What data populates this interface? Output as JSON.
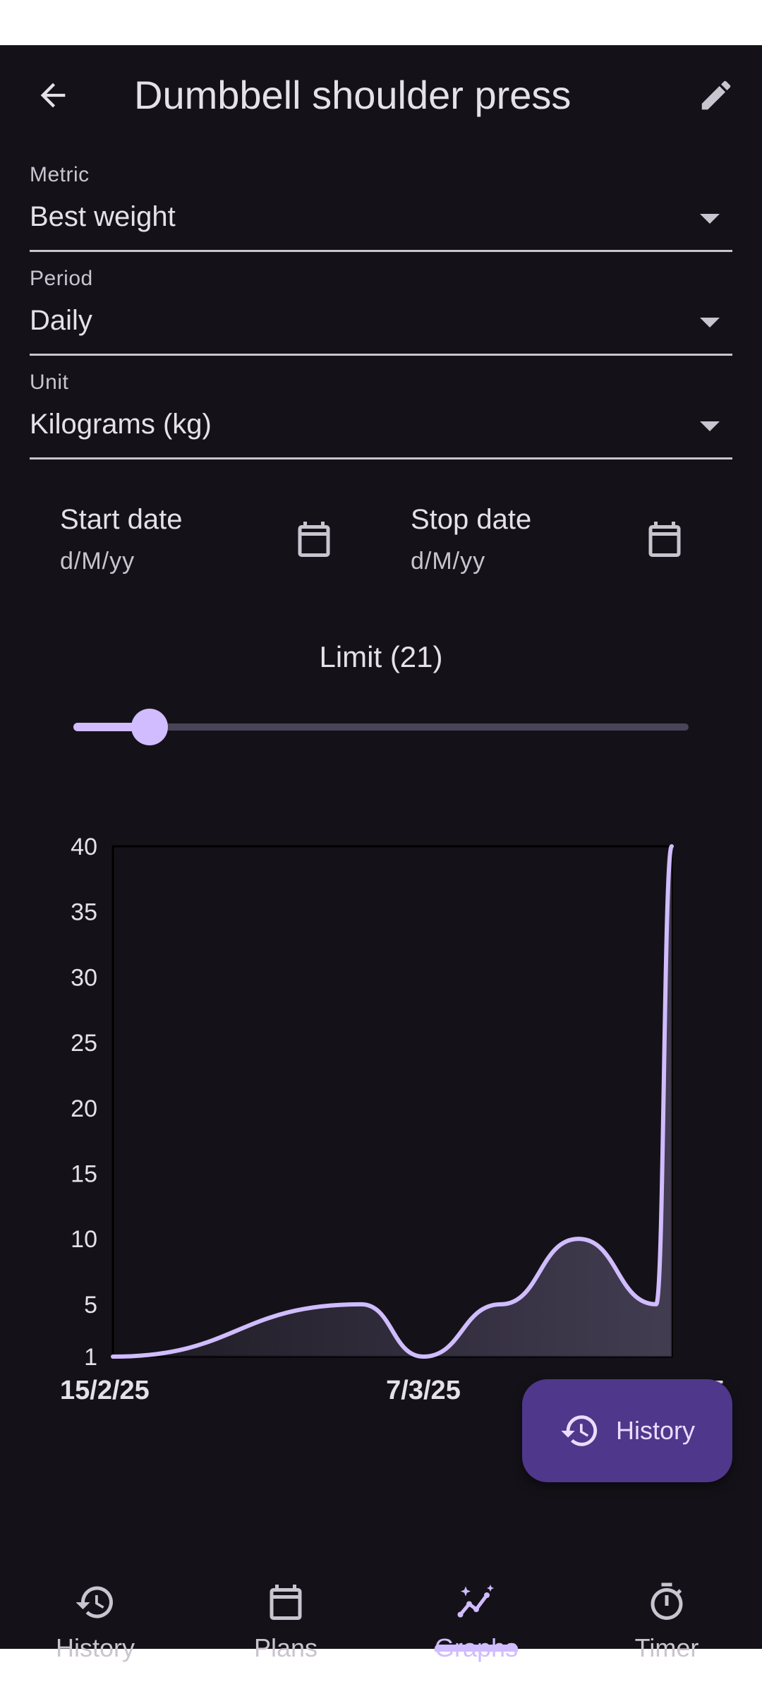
{
  "header": {
    "title": "Dumbbell shoulder press"
  },
  "fields": {
    "metric": {
      "label": "Metric",
      "value": "Best weight"
    },
    "period": {
      "label": "Period",
      "value": "Daily"
    },
    "unit": {
      "label": "Unit",
      "value": "Kilograms (kg)"
    }
  },
  "dates": {
    "start": {
      "label": "Start date",
      "placeholder": "d/M/yy"
    },
    "stop": {
      "label": "Stop date",
      "placeholder": "d/M/yy"
    }
  },
  "limit": {
    "label": "Limit (21)",
    "value": 21,
    "fraction": 0.12
  },
  "fab": {
    "label": "History",
    "icon": "history-icon"
  },
  "nav": {
    "items": [
      {
        "label": "History",
        "icon": "history-icon"
      },
      {
        "label": "Plans",
        "icon": "calendar-icon"
      },
      {
        "label": "Graphs",
        "icon": "graph-sparkle-icon",
        "active": true
      },
      {
        "label": "Timer",
        "icon": "timer-icon"
      }
    ]
  },
  "colors": {
    "background": "#141218",
    "accent": "#d0bcff",
    "fab": "#4f378b",
    "text": "#e6e0e9"
  },
  "chart_data": {
    "type": "line",
    "x_ticks": [
      "15/2/25",
      "7/3/25",
      "23/3/25"
    ],
    "y_ticks": [
      1,
      5,
      10,
      15,
      20,
      25,
      30,
      35,
      40
    ],
    "ylim": [
      1,
      40
    ],
    "series": [
      {
        "points": [
          [
            "15/2/25",
            1
          ],
          [
            "3/3/25",
            5
          ],
          [
            "7/3/25",
            1
          ],
          [
            "12/3/25",
            5
          ],
          [
            "17/3/25",
            10
          ],
          [
            "22/3/25",
            5
          ],
          [
            "23/3/25",
            40
          ]
        ]
      }
    ],
    "fill_under_line": true
  }
}
